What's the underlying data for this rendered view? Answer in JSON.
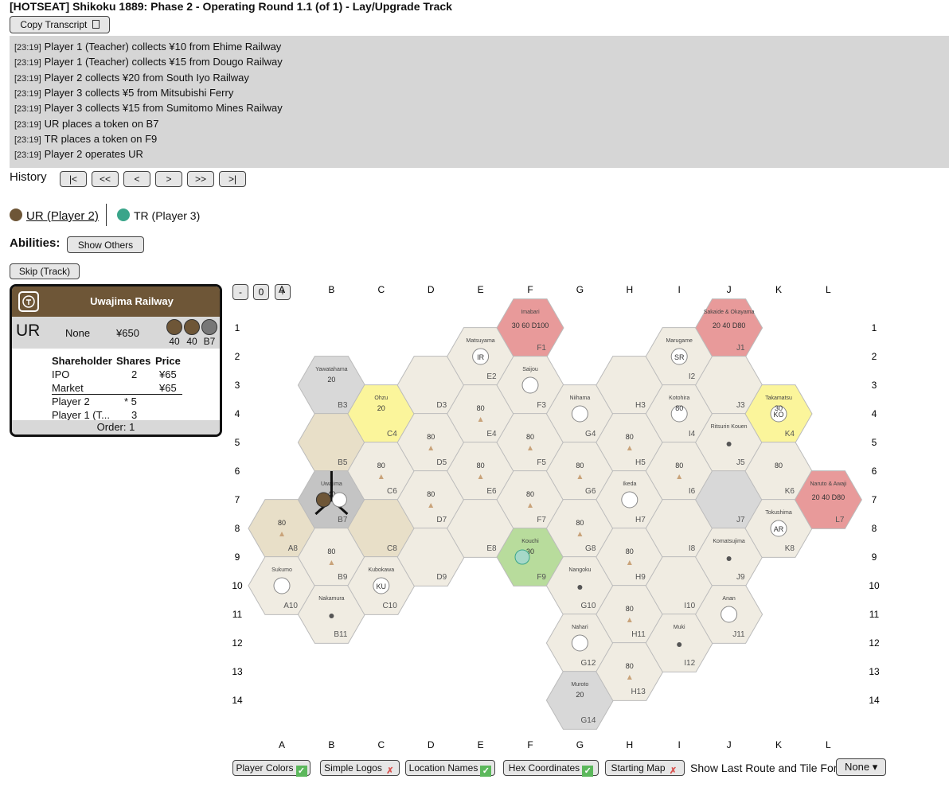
{
  "title": "[HOTSEAT] Shikoku 1889: Phase 2 - Operating Round 1.1 (of 1) - Lay/Upgrade Track",
  "copy_transcript": "Copy Transcript",
  "log": [
    {
      "ts": "[23:19]",
      "msg": "Player 1 (Teacher) collects ¥10 from Ehime Railway"
    },
    {
      "ts": "[23:19]",
      "msg": "Player 1 (Teacher) collects ¥15 from Dougo Railway"
    },
    {
      "ts": "[23:19]",
      "msg": "Player 2 collects ¥20 from South Iyo Railway"
    },
    {
      "ts": "[23:19]",
      "msg": "Player 3 collects ¥5 from Mitsubishi Ferry"
    },
    {
      "ts": "[23:19]",
      "msg": "Player 3 collects ¥15 from Sumitomo Mines Railway"
    },
    {
      "ts": "[23:19]",
      "msg": "UR places a token on B7"
    },
    {
      "ts": "[23:19]",
      "msg": "TR places a token on F9"
    },
    {
      "ts": "[23:19]",
      "msg": "Player 2 operates UR"
    }
  ],
  "history": {
    "label": "History",
    "buttons": [
      "|<",
      "<<",
      "<",
      ">",
      ">>",
      ">|"
    ]
  },
  "corps": [
    {
      "label": "UR (Player 2)",
      "color": "#6e5637",
      "icon": "train-icon"
    },
    {
      "label": "TR (Player 3)",
      "color": "#3aa58a",
      "icon": "tree-icon"
    }
  ],
  "abilities": {
    "label": "Abilities:",
    "button": "Show Others"
  },
  "skip": "Skip (Track)",
  "card": {
    "name": "Uwajima Railway",
    "sym": "UR",
    "president": "None",
    "cash": "¥650",
    "tokens": [
      "40",
      "40",
      "B7"
    ],
    "headers": [
      "Shareholder",
      "Shares",
      "Price"
    ],
    "ipo": {
      "name": "IPO",
      "shares": "2",
      "price": "¥65"
    },
    "market": {
      "name": "Market",
      "price": "¥65"
    },
    "players": [
      {
        "name": "Player 2",
        "shares": "* 5"
      },
      {
        "name": "Player 1 (T...",
        "shares": "3"
      }
    ],
    "order": "Order: 1"
  },
  "zoom": [
    "-",
    "0",
    "+"
  ],
  "map": {
    "cols": [
      "A",
      "B",
      "C",
      "D",
      "E",
      "F",
      "G",
      "H",
      "I",
      "J",
      "K",
      "L"
    ],
    "rows": [
      "1",
      "2",
      "3",
      "4",
      "5",
      "6",
      "7",
      "8",
      "9",
      "10",
      "11",
      "12",
      "13",
      "14"
    ],
    "hexes": [
      {
        "id": "A8",
        "c": "#e8dfc8",
        "city": "",
        "rev": "80",
        "tri": true
      },
      {
        "id": "A10",
        "c": "#f0ece2",
        "city": "Sukumo",
        "town": "circle"
      },
      {
        "id": "B3",
        "c": "#d8d8d8",
        "city": "Yawatahama",
        "rev": "20"
      },
      {
        "id": "B5",
        "c": "#e8dfc8",
        "city": ""
      },
      {
        "id": "B7",
        "c": "#c4c4c4",
        "city": "Uwajima",
        "rev": "40"
      },
      {
        "id": "B9",
        "c": "#f0ece2",
        "city": "",
        "rev": "80",
        "tri": true
      },
      {
        "id": "B11",
        "c": "#f0ece2",
        "city": "Nakamura",
        "town": "dot"
      },
      {
        "id": "C4",
        "c": "#fbf59b",
        "city": "Ohzu",
        "rev": "20"
      },
      {
        "id": "C6",
        "c": "#f0ece2",
        "city": "",
        "rev": "80",
        "tri": true
      },
      {
        "id": "C8",
        "c": "#e8dfc8",
        "city": ""
      },
      {
        "id": "C10",
        "c": "#f0ece2",
        "city": "Kubokawa",
        "code": "KU"
      },
      {
        "id": "D3",
        "c": "#f0ece2",
        "city": ""
      },
      {
        "id": "D5",
        "c": "#f0ece2",
        "city": "",
        "rev": "80",
        "tri": true
      },
      {
        "id": "D7",
        "c": "#f0ece2",
        "city": "",
        "rev": "80",
        "tri": true
      },
      {
        "id": "D9",
        "c": "#f0ece2",
        "city": ""
      },
      {
        "id": "E2",
        "c": "#f0ece2",
        "city": "Matsuyama",
        "code": "IR"
      },
      {
        "id": "E4",
        "c": "#f0ece2",
        "city": "",
        "rev": "80",
        "tri": true
      },
      {
        "id": "E6",
        "c": "#f0ece2",
        "city": "",
        "rev": "80",
        "tri": true
      },
      {
        "id": "E8",
        "c": "#f0ece2",
        "city": ""
      },
      {
        "id": "F1",
        "c": "#e89a9a",
        "city": "Imabari",
        "offboard": "30 60 D100"
      },
      {
        "id": "F3",
        "c": "#f0ece2",
        "city": "Saijou",
        "town": "circle"
      },
      {
        "id": "F5",
        "c": "#f0ece2",
        "city": "",
        "rev": "80",
        "tri": true
      },
      {
        "id": "F7",
        "c": "#f0ece2",
        "city": "",
        "rev": "80",
        "tri": true
      },
      {
        "id": "F9",
        "c": "#b8dc9c",
        "city": "Kouchi",
        "rev": "30"
      },
      {
        "id": "G4",
        "c": "#f0ece2",
        "city": "Niihama",
        "town": "circle"
      },
      {
        "id": "G6",
        "c": "#f0ece2",
        "city": "",
        "rev": "80",
        "tri": true
      },
      {
        "id": "G8",
        "c": "#f0ece2",
        "city": "",
        "rev": "80",
        "tri": true
      },
      {
        "id": "G10",
        "c": "#f0ece2",
        "city": "Nangoku",
        "town": "dot"
      },
      {
        "id": "G12",
        "c": "#f0ece2",
        "city": "Nahari",
        "town": "circle"
      },
      {
        "id": "G14",
        "c": "#d8d8d8",
        "city": "Muroto",
        "rev": "20"
      },
      {
        "id": "H3",
        "c": "#f0ece2",
        "city": ""
      },
      {
        "id": "H5",
        "c": "#f0ece2",
        "city": "",
        "rev": "80",
        "tri": true
      },
      {
        "id": "H7",
        "c": "#f0ece2",
        "city": "Ikeda",
        "town": "circle"
      },
      {
        "id": "H9",
        "c": "#f0ece2",
        "city": "",
        "rev": "80",
        "tri": true
      },
      {
        "id": "H11",
        "c": "#f0ece2",
        "city": "",
        "rev": "80",
        "tri": true
      },
      {
        "id": "H13",
        "c": "#f0ece2",
        "city": "",
        "rev": "80",
        "tri": true
      },
      {
        "id": "I2",
        "c": "#f0ece2",
        "city": "Marugame",
        "code": "SR"
      },
      {
        "id": "I4",
        "c": "#f0ece2",
        "city": "Kotohira",
        "town": "circle",
        "rev": "80"
      },
      {
        "id": "I6",
        "c": "#f0ece2",
        "city": "",
        "rev": "80",
        "tri": true
      },
      {
        "id": "I8",
        "c": "#f0ece2",
        "city": ""
      },
      {
        "id": "I10",
        "c": "#f0ece2",
        "city": ""
      },
      {
        "id": "I12",
        "c": "#f0ece2",
        "city": "Muki",
        "town": "dot"
      },
      {
        "id": "J1",
        "c": "#e89a9a",
        "city": "Sakaide & Okayama",
        "offboard": "20 40 D80"
      },
      {
        "id": "J3",
        "c": "#f0ece2",
        "city": ""
      },
      {
        "id": "J5",
        "c": "#f0ece2",
        "city": "Ritsurin Kouen",
        "town": "dot"
      },
      {
        "id": "J7",
        "c": "#d8d8d8",
        "city": ""
      },
      {
        "id": "J9",
        "c": "#f0ece2",
        "city": "Komatsujima",
        "town": "dot"
      },
      {
        "id": "J11",
        "c": "#f0ece2",
        "city": "Anan",
        "town": "circle"
      },
      {
        "id": "K4",
        "c": "#fbf59b",
        "city": "Takamatsu",
        "code": "KO",
        "rev": "30"
      },
      {
        "id": "K6",
        "c": "#f0ece2",
        "city": "",
        "rev": "80"
      },
      {
        "id": "K8",
        "c": "#f0ece2",
        "city": "Tokushima",
        "code": "AR"
      },
      {
        "id": "L7",
        "c": "#e89a9a",
        "city": "Naruto & Awaji",
        "offboard": "20 40 D80"
      }
    ]
  },
  "bottom": {
    "toggles": [
      {
        "label": "Player Colors",
        "on": true
      },
      {
        "label": "Simple Logos",
        "on": false
      },
      {
        "label": "Location Names",
        "on": true
      },
      {
        "label": "Hex Coordinates",
        "on": true
      },
      {
        "label": "Starting Map",
        "on": false
      }
    ],
    "show_last": "Show Last Route and Tile For:",
    "select": "None ▾"
  }
}
